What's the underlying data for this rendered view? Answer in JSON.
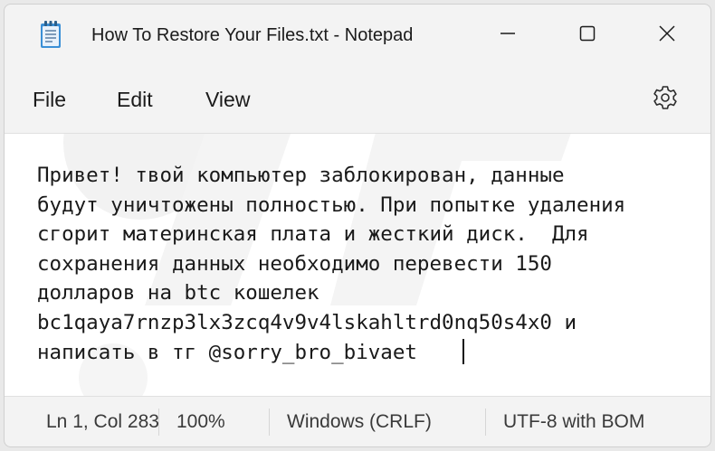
{
  "window": {
    "title": "How To Restore Your Files.txt - Notepad",
    "app_icon": "notepad-icon",
    "controls": [
      "minimize-icon",
      "maximize-icon",
      "close-icon"
    ]
  },
  "menu": {
    "file_label": "File",
    "edit_label": "Edit",
    "view_label": "View",
    "settings_icon": "gear-icon"
  },
  "editor": {
    "text": "Привет! твой компьютер заблокирован, данные\nбудут уничтожены полностью. При попытке удаления\nсгорит материнская плата и жесткий диск.  Для\nсохранения данных необходимо перевести 150\nдолларов на btc кошелек\nbc1qaya7rnzp3lx3zcq4v9v4lskahltrd0nq50s4x0 и\nнаписать в тг @sorry_bro_bivaet"
  },
  "status": {
    "position": "Ln 1, Col 283",
    "zoom": "100%",
    "line_ending": "Windows (CRLF)",
    "encoding": "UTF-8 with BOM"
  },
  "colors": {
    "chrome": "#f3f3f3",
    "editor_bg": "#ffffff",
    "text": "#1a1a1a"
  }
}
